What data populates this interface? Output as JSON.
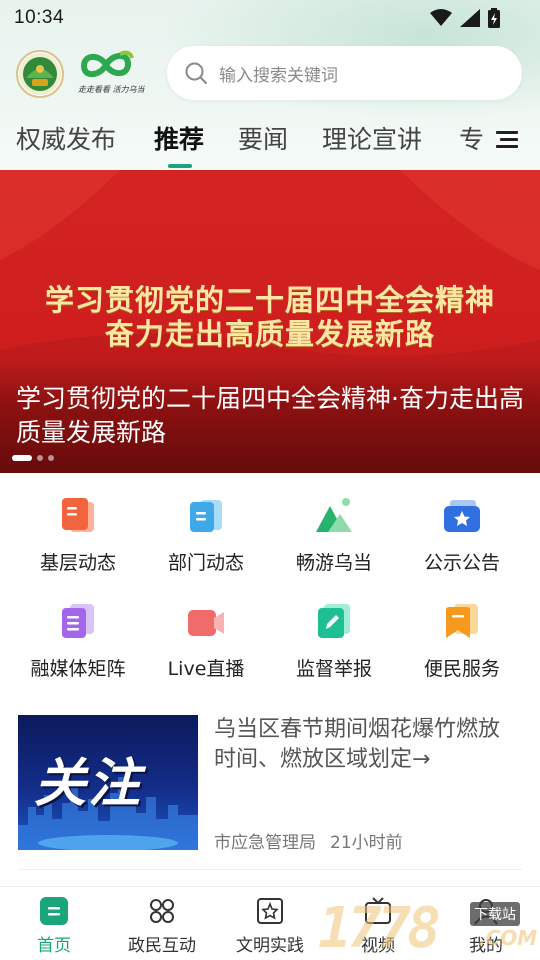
{
  "status_bar": {
    "time": "10:34",
    "icons": [
      "wifi-icon",
      "signal-icon",
      "battery-icon"
    ]
  },
  "header": {
    "brand_slogan": "走走看看 活力乌当",
    "search": {
      "placeholder": "输入搜索关键词",
      "icon": "search-icon"
    }
  },
  "tabs": {
    "items": [
      {
        "label": "权威发布",
        "active": false
      },
      {
        "label": "推荐",
        "active": true
      },
      {
        "label": "要闻",
        "active": false
      },
      {
        "label": "理论宣讲",
        "active": false
      },
      {
        "label": "专",
        "active": false
      }
    ],
    "menu_icon": "menu-icon",
    "accent": "#1aa57a"
  },
  "banner": {
    "headline_line1": "学习贯彻党的二十届四中全会精神",
    "headline_line2": "奋力走出高质量发展新路",
    "caption": "学习贯彻党的二十届四中全会精神·奋力走出高质量发展新路",
    "slide_count": 3,
    "active_slide": 1,
    "background": "#d42323"
  },
  "quick_links": [
    {
      "label": "基层动态",
      "icon": "document-icon"
    },
    {
      "label": "部门动态",
      "icon": "notes-icon"
    },
    {
      "label": "畅游乌当",
      "icon": "mountain-icon"
    },
    {
      "label": "公示公告",
      "icon": "star-notice-icon"
    },
    {
      "label": "融媒体矩阵",
      "icon": "media-matrix-icon"
    },
    {
      "label": "Live直播",
      "icon": "live-camera-icon"
    },
    {
      "label": "监督举报",
      "icon": "report-pen-icon"
    },
    {
      "label": "便民服务",
      "icon": "bookmark-service-icon"
    }
  ],
  "news": [
    {
      "thumb_word": "关注",
      "title": "乌当区春节期间烟花爆竹燃放时间、燃放区域划定→",
      "source": "市应急管理局",
      "time": "21小时前"
    }
  ],
  "bottom_nav": [
    {
      "label": "首页",
      "icon": "home-icon",
      "active": true
    },
    {
      "label": "政民互动",
      "icon": "interaction-icon",
      "active": false
    },
    {
      "label": "文明实践",
      "icon": "civilization-star-icon",
      "active": false
    },
    {
      "label": "视频",
      "icon": "tv-icon",
      "active": false
    },
    {
      "label": "我的",
      "icon": "profile-icon",
      "active": false
    }
  ],
  "watermark": {
    "digits": "1778",
    "tag": "下载站",
    "suffix": ".COM"
  }
}
